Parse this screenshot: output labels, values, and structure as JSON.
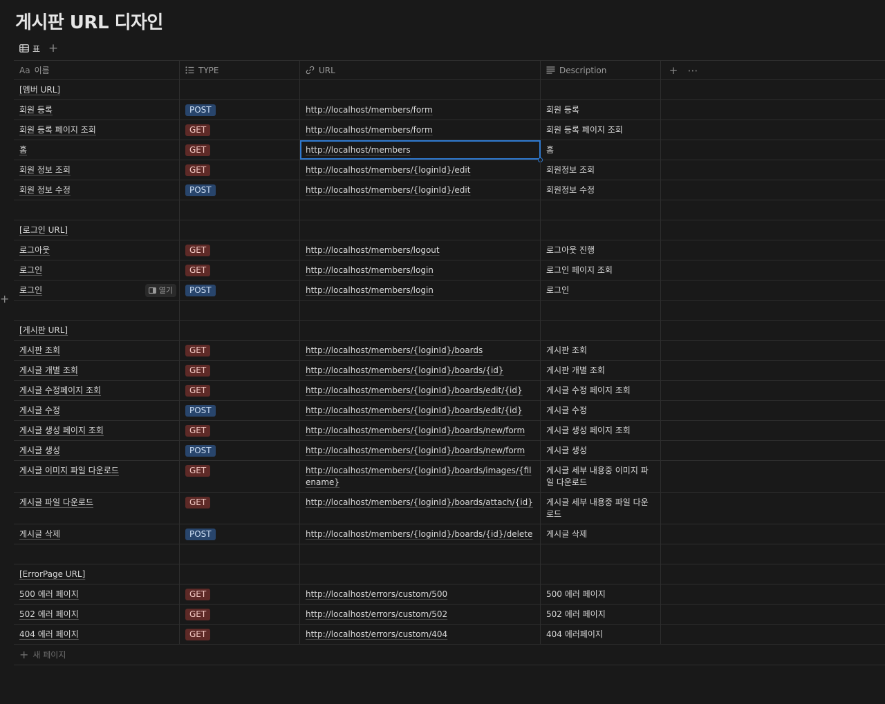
{
  "title": "게시판 URL 디자인",
  "view": {
    "tab_label": "표",
    "add_view_icon": "plus-icon"
  },
  "columns": {
    "name": "이름",
    "name_prefix": "Aa",
    "type": "TYPE",
    "url": "URL",
    "description": "Description"
  },
  "header_actions": {
    "add_icon": "plus-icon",
    "more_icon": "ellipsis-icon"
  },
  "open_button_label": "열기",
  "new_page_label": "새 페이지",
  "colors": {
    "GET": "#5e2a27",
    "POST": "#28456c",
    "selection": "#2f7ad1",
    "background": "#191919"
  },
  "rows": [
    {
      "name": "[멤버 URL]",
      "type": "",
      "url": "",
      "desc": ""
    },
    {
      "name": "회원 등록",
      "type": "POST",
      "url": "http://localhost/members/form",
      "desc": "회원 등록"
    },
    {
      "name": "회원 등록 페이지 조회",
      "type": "GET",
      "url": "http://localhost/members/form",
      "desc": "회원 등록 페이지 조회"
    },
    {
      "name": "홈",
      "type": "GET",
      "url": "http://localhost/members",
      "desc": "홈",
      "selected": true
    },
    {
      "name": "회원 정보 조회",
      "type": "GET",
      "url": "http://localhost/members/{loginId}/edit",
      "desc": "회원정보 조회"
    },
    {
      "name": "회원 정보 수정",
      "type": "POST",
      "url": "http://localhost/members/{loginId}/edit",
      "desc": "회원정보 수정"
    },
    {
      "name": "",
      "type": "",
      "url": "",
      "desc": ""
    },
    {
      "name": "[로그인 URL]",
      "type": "",
      "url": "",
      "desc": ""
    },
    {
      "name": "로그아웃",
      "type": "GET",
      "url": "http://localhost/members/logout",
      "desc": "로그아웃 진행"
    },
    {
      "name": "로그인",
      "type": "GET",
      "url": "http://localhost/members/login",
      "desc": "로그인 페이지 조회"
    },
    {
      "name": "로그인",
      "type": "POST",
      "url": "http://localhost/members/login",
      "desc": "로그인",
      "hover": true
    },
    {
      "name": "",
      "type": "",
      "url": "",
      "desc": ""
    },
    {
      "name": "[게시판 URL]",
      "type": "",
      "url": "",
      "desc": ""
    },
    {
      "name": "게시판 조회",
      "type": "GET",
      "url": "http://localhost/members/{loginId}/boards",
      "desc": "게시판 조회"
    },
    {
      "name": "게시글 개별 조회",
      "type": "GET",
      "url": "http://localhost/members/{loginId}/boards/{id}",
      "desc": "게시판 개별 조회"
    },
    {
      "name": "게시글 수정페이지 조회",
      "type": "GET",
      "url": "http://localhost/members/{loginId}/boards/edit/{id}",
      "desc": "게시글 수정 페이지 조회"
    },
    {
      "name": "게시글 수정",
      "type": "POST",
      "url": "http://localhost/members/{loginId}/boards/edit/{id}",
      "desc": "게시글 수정"
    },
    {
      "name": "게시글 생성 페이지 조회",
      "type": "GET",
      "url": "http://localhost/members/{loginId}/boards/new/form",
      "desc": "게시글 생성 페이지 조회"
    },
    {
      "name": "게시글 생성",
      "type": "POST",
      "url": "http://localhost/members/{loginId}/boards/new/form",
      "desc": "게시글 생성"
    },
    {
      "name": "게시글 이미지 파일 다운로드",
      "type": "GET",
      "url": "http://localhost/members/{loginId}/boards/images/{filename}",
      "desc": "게시글 세부 내용중 이미지 파일 다운로드"
    },
    {
      "name": "게시글 파일 다운로드",
      "type": "GET",
      "url": "http://localhost/members/{loginId}/boards/attach/{id}",
      "desc": "게시글 세부 내용중 파일 다운로드"
    },
    {
      "name": "게시글 삭제",
      "type": "POST",
      "url": "http://localhost/members/{loginId}/boards/{id}/delete",
      "desc": "게시글 삭제"
    },
    {
      "name": "",
      "type": "",
      "url": "",
      "desc": ""
    },
    {
      "name": "[ErrorPage URL]",
      "type": "",
      "url": "",
      "desc": ""
    },
    {
      "name": "500 에러 페이지",
      "type": "GET",
      "url": "http://localhost/errors/custom/500",
      "desc": "500 에러 페이지"
    },
    {
      "name": "502 에러 페이지",
      "type": "GET",
      "url": "http://localhost/errors/custom/502",
      "desc": "502 에러 페이지"
    },
    {
      "name": "404 에러 페이지",
      "type": "GET",
      "url": "http://localhost/errors/custom/404",
      "desc": "404 에러페이지"
    }
  ]
}
